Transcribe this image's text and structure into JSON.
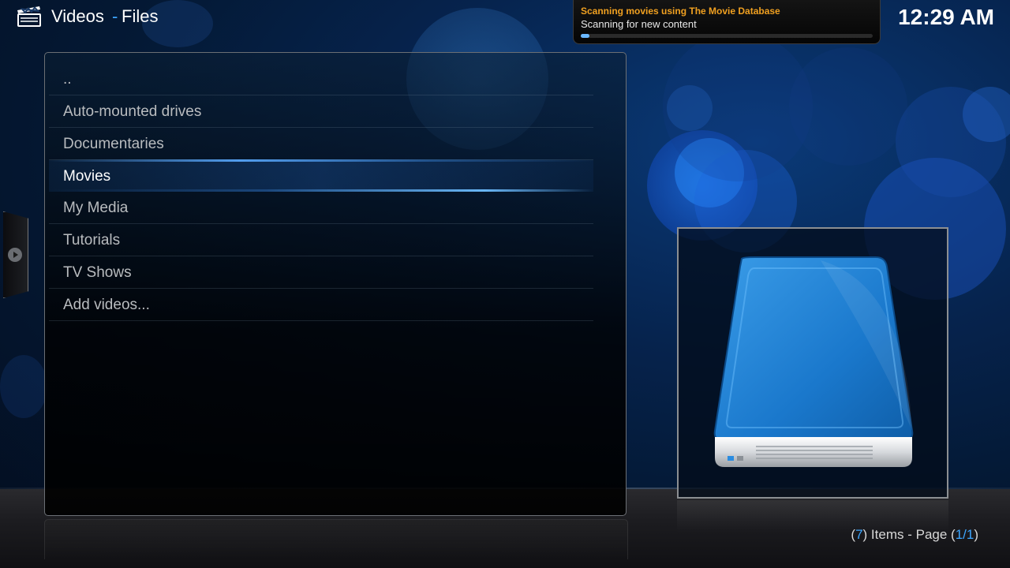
{
  "header": {
    "title": "Videos",
    "separator": "-",
    "subtitle": "Files",
    "icon": "clapperboard-icon"
  },
  "clock": "12:29 AM",
  "notification": {
    "title": "Scanning movies using The Movie Database",
    "message": "Scanning for new content",
    "progress": 0.03,
    "title_color": "#f0a020",
    "bar_color": "#6ab8ff"
  },
  "list": {
    "items": [
      {
        "label": ".."
      },
      {
        "label": "Auto-mounted drives"
      },
      {
        "label": "Documentaries"
      },
      {
        "label": "Movies",
        "selected": true
      },
      {
        "label": "My Media"
      },
      {
        "label": "Tutorials"
      },
      {
        "label": "TV Shows"
      },
      {
        "label": "Add videos..."
      }
    ]
  },
  "thumbnail": {
    "icon": "hard-drive-icon"
  },
  "footer": {
    "open_paren": "(",
    "count": "7",
    "items_text": ") Items - Page (",
    "page": "1/1",
    "close_paren": ")"
  },
  "side_handle": {
    "icon": "arrow-right-icon"
  },
  "colors": {
    "accent": "#3da6ff",
    "background": "#06234d"
  }
}
